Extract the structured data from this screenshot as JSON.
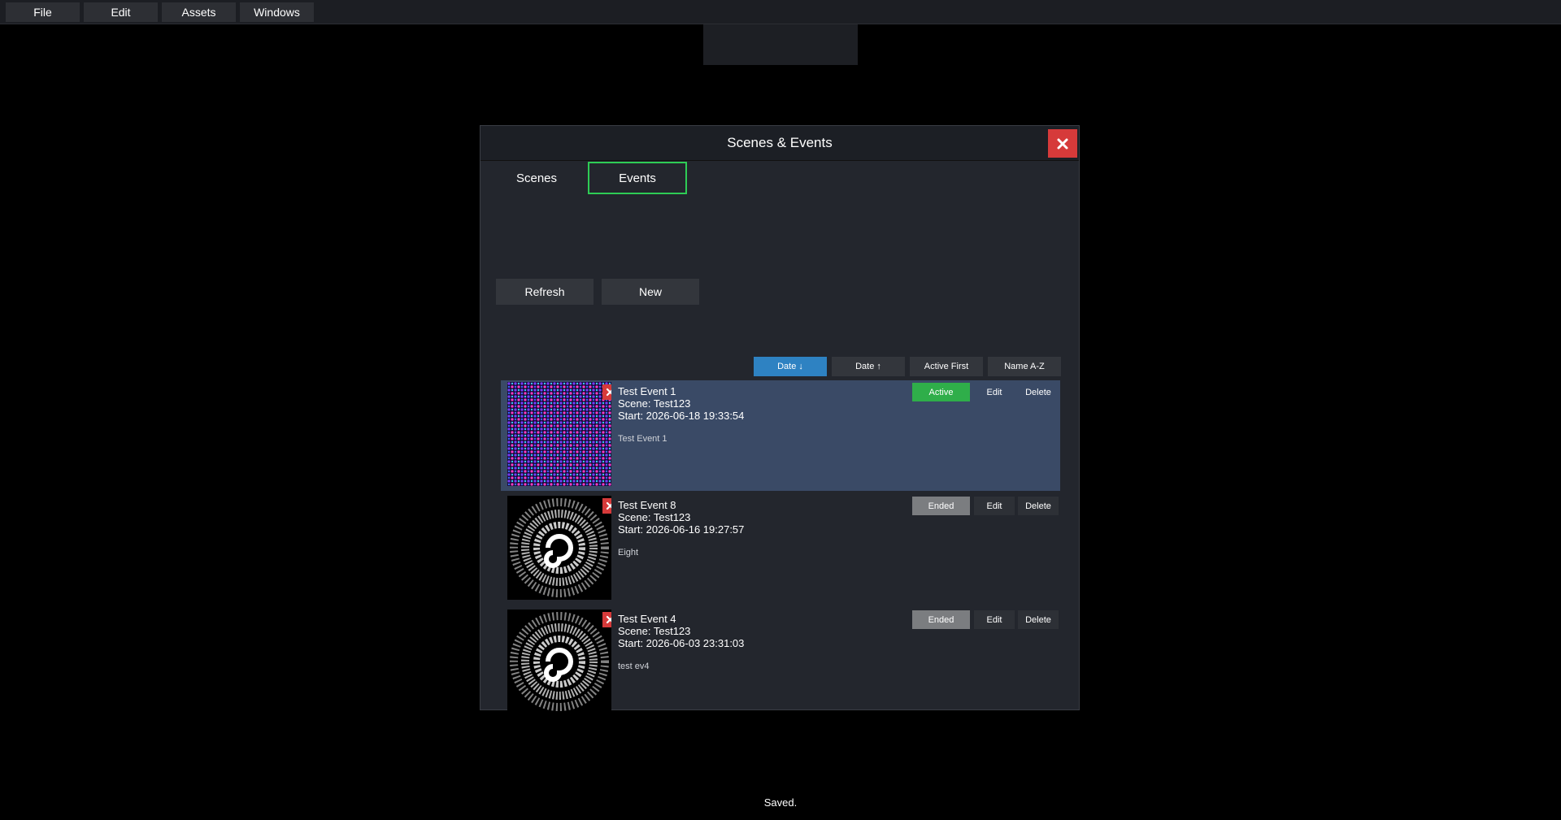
{
  "menubar": {
    "items": [
      {
        "label": "File"
      },
      {
        "label": "Edit"
      },
      {
        "label": "Assets"
      },
      {
        "label": "Windows"
      }
    ]
  },
  "dialog": {
    "title": "Scenes & Events",
    "close_icon": "close-icon",
    "tabs": [
      {
        "label": "Scenes",
        "active": false
      },
      {
        "label": "Events",
        "active": true
      }
    ],
    "refresh_label": "Refresh",
    "new_label": "New",
    "sort_buttons": [
      {
        "label": "Date ↓",
        "selected": true
      },
      {
        "label": "Date ↑",
        "selected": false
      },
      {
        "label": "Active First",
        "selected": false
      },
      {
        "label": "Name A-Z",
        "selected": false
      }
    ],
    "events": [
      {
        "name": "Test Event 1",
        "scene": "Scene: Test123",
        "start": "Start: 2026-06-18 19:33:54",
        "description": "Test Event 1",
        "status": "Active",
        "edit_label": "Edit",
        "delete_label": "Delete",
        "thumbnail": "colorful-grid-thumbnail"
      },
      {
        "name": "Test Event 8",
        "scene": "Scene: Test123",
        "start": "Start: 2026-06-16 19:27:57",
        "description": "Eight",
        "status": "Ended",
        "edit_label": "Edit",
        "delete_label": "Delete",
        "thumbnail": "spiral-galaxy-thumbnail"
      },
      {
        "name": "Test Event 4",
        "scene": "Scene: Test123",
        "start": "Start: 2026-06-03 23:31:03",
        "description": "test ev4",
        "status": "Ended",
        "edit_label": "Edit",
        "delete_label": "Delete",
        "thumbnail": "spiral-galaxy-thumbnail"
      }
    ]
  },
  "status_message": "Saved.",
  "colors": {
    "active_tab_border": "#2ecc55",
    "active_status": "#2fae4a",
    "ended_status": "#7b7d80",
    "selected_sort": "#2e82c2",
    "close_button": "#d63a3a",
    "highlight_row": "#3a4a66"
  }
}
